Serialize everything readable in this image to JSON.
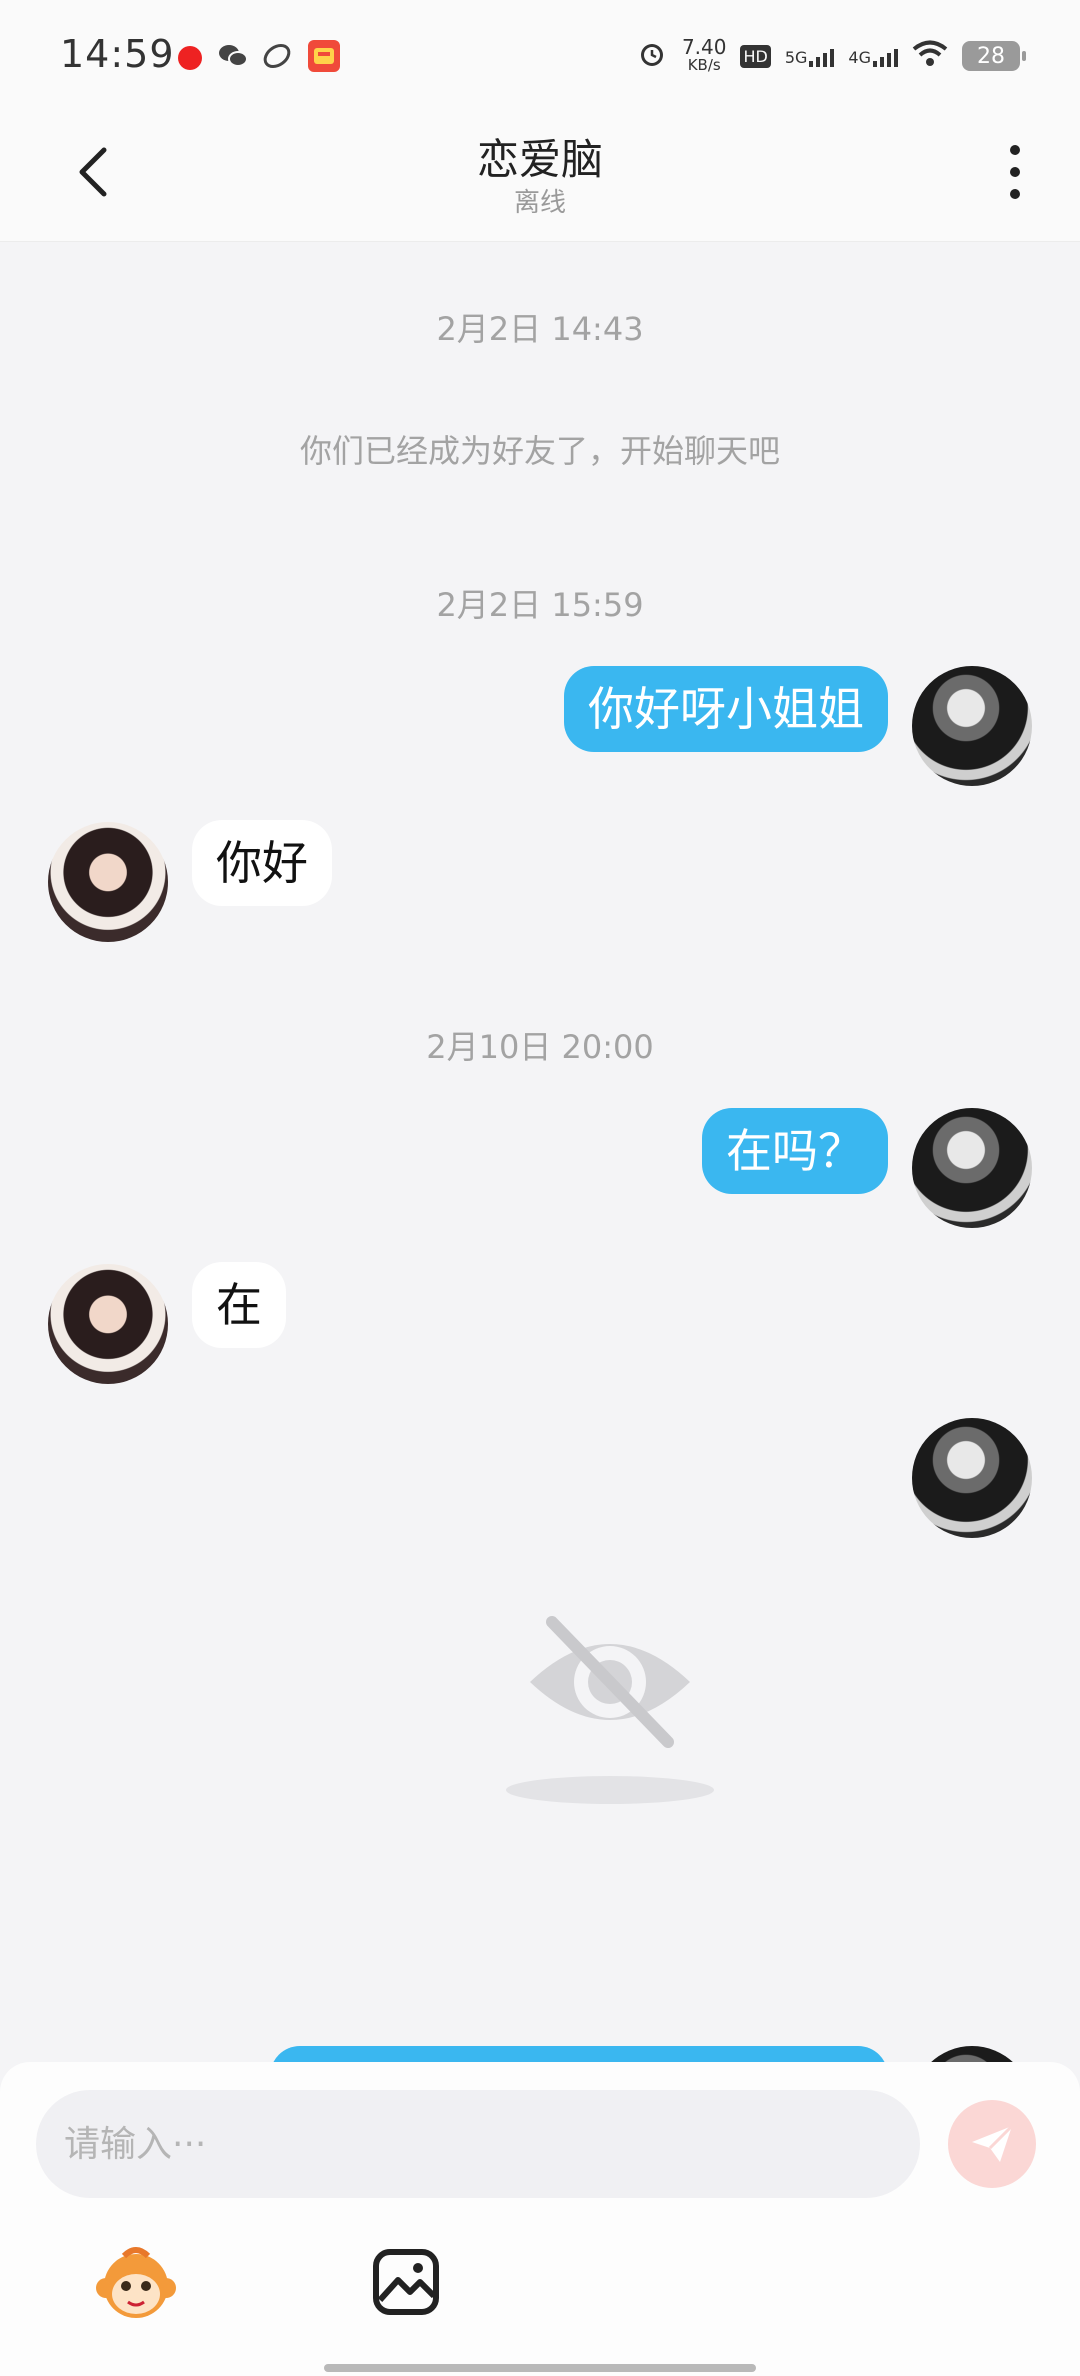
{
  "status_bar": {
    "time": "14:59",
    "net_speed_value": "7.40",
    "net_speed_unit": "KB/s",
    "hd_label": "HD",
    "sim1_label": "5G",
    "sim2_label": "4G",
    "battery": "28",
    "icons": [
      "notification-app-icon",
      "wechat-icon",
      "app-icon",
      "calendar-app-icon",
      "alarm-icon",
      "wifi-icon"
    ]
  },
  "header": {
    "title": "恋爱脑",
    "subtitle": "离线",
    "back_icon": "chevron-left-icon",
    "more_icon": "more-vertical-icon"
  },
  "chat": {
    "timestamps": [
      "2月2日 14:43",
      "2月2日 15:59",
      "2月10日 20:00"
    ],
    "system_message": "你们已经成为好友了，开始聊天吧",
    "messages": [
      {
        "from": "me",
        "text": "你好呀小姐姐"
      },
      {
        "from": "her",
        "text": "你好"
      },
      {
        "from": "me",
        "text": "在吗？"
      },
      {
        "from": "her",
        "text": "在"
      },
      {
        "from": "me",
        "text": ""
      }
    ],
    "hidden_content_icon": "eye-off-icon"
  },
  "composer": {
    "placeholder": "请输入···",
    "value": "",
    "send_icon": "send-icon",
    "emoji_icon": "monkey-emoji-icon",
    "image_icon": "image-icon"
  },
  "colors": {
    "accent_bubble": "#3ab7f0",
    "send_button_disabled": "#fbd7d5",
    "background": "#f4f4f6"
  }
}
